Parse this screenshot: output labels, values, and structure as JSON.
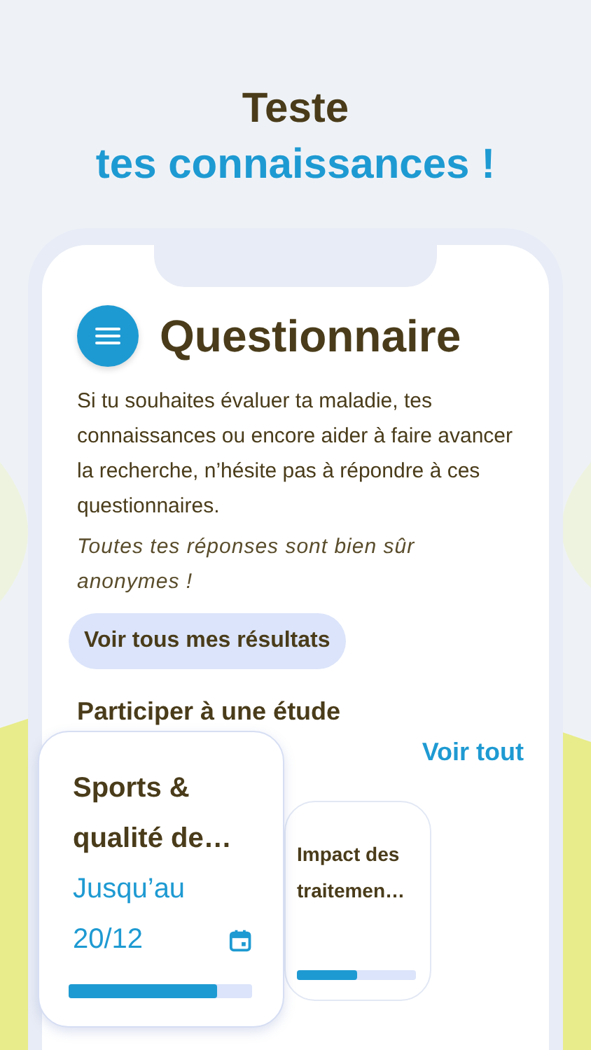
{
  "headline": {
    "line_1": "Teste",
    "line_2": "tes connaissances !"
  },
  "screen": {
    "title": "Questionnaire",
    "intro": "Si tu souhaites évaluer ta maladie, tes connaissances ou encore aider à faire avancer la recherche, n’hésite pas à répondre à ces questionnaires.",
    "note": "Toutes tes réponses sont bien sûr anonymes !",
    "results_button": "Voir tous mes résultats",
    "section_title": "Participer à une étude",
    "see_all": "Voir tout",
    "studies": [
      {
        "title": "Sports & qualité de…",
        "deadline": "Jusqu’au 20/12",
        "level": 0.81,
        "featured": true
      },
      {
        "title": "Impact des traitemen…",
        "level": 0.51,
        "featured": false
      }
    ]
  }
}
